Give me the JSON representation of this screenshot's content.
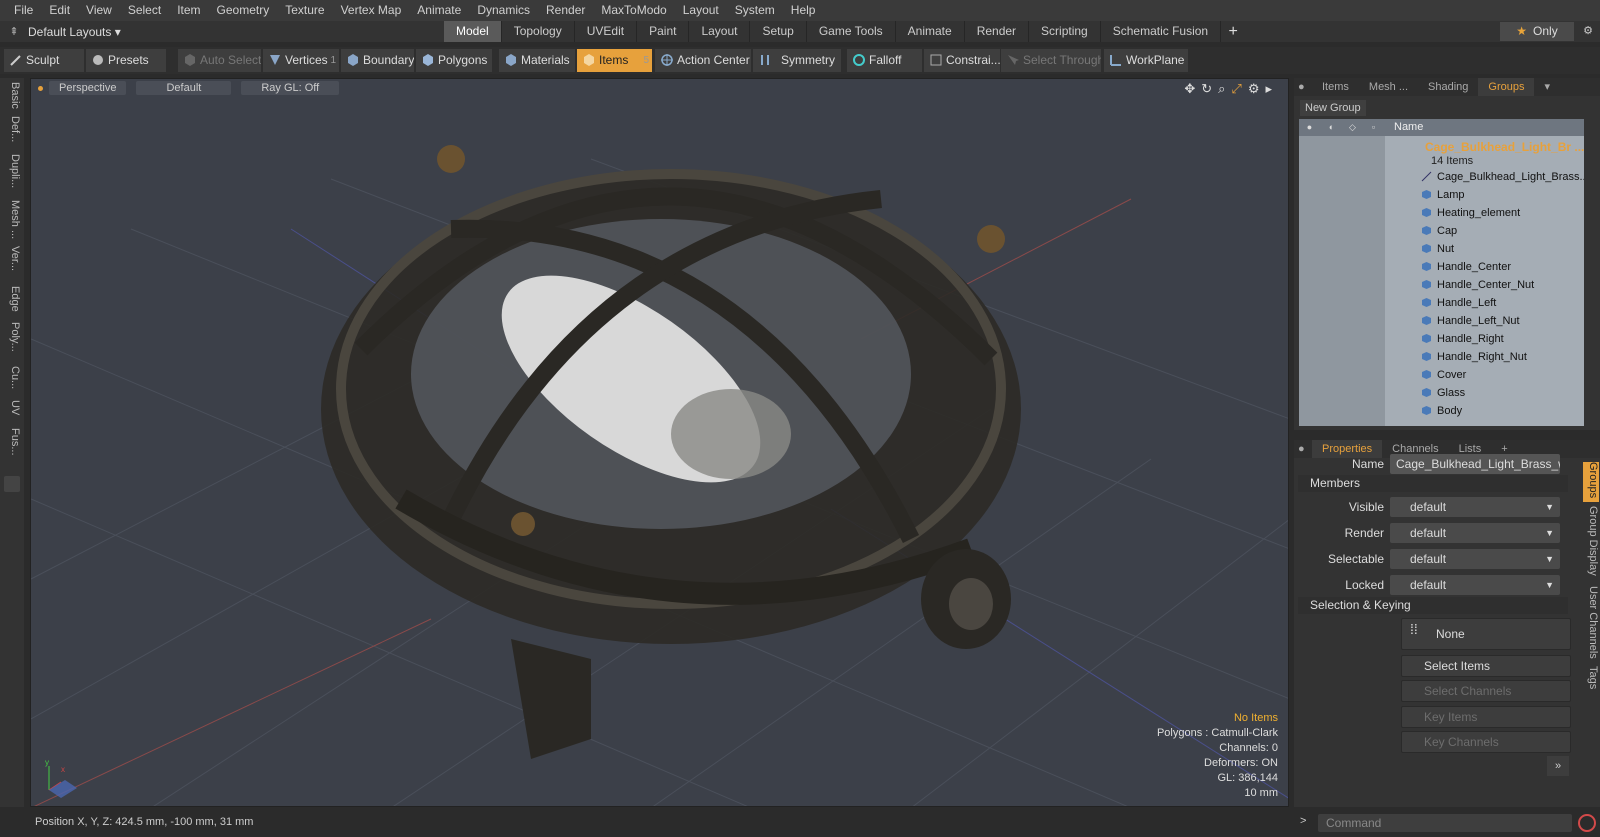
{
  "menu": [
    "File",
    "Edit",
    "View",
    "Select",
    "Item",
    "Geometry",
    "Texture",
    "Vertex Map",
    "Animate",
    "Dynamics",
    "Render",
    "MaxToModo",
    "Layout",
    "System",
    "Help"
  ],
  "layout_bar": {
    "layout_select": "Default Layouts ▾",
    "tabs": [
      "Model",
      "Topology",
      "UVEdit",
      "Paint",
      "Layout",
      "Setup",
      "Game Tools",
      "Animate",
      "Render",
      "Scripting",
      "Schematic Fusion"
    ],
    "active_tab": "Model",
    "only_label": "Only"
  },
  "toolbar": {
    "sculpt": "Sculpt",
    "presets": "Presets",
    "auto_select": "Auto Select",
    "vertices": "Vertices",
    "vertices_count": "1",
    "boundary": "Boundary",
    "polygons": "Polygons",
    "materials": "Materials",
    "items": "Items",
    "items_count": "5",
    "action_center": "Action Center",
    "symmetry": "Symmetry",
    "falloff": "Falloff",
    "constraints": "Constrai...",
    "select_through": "Select Through",
    "workplane": "WorkPlane"
  },
  "left_tabs": [
    "Basic",
    "Def...",
    "Dupli...",
    "Mesh ...",
    "Ver...",
    "Edge",
    "Poly...",
    "Cu...",
    "UV",
    "Fus..."
  ],
  "viewport": {
    "view_mode": "Perspective",
    "shading": "Default",
    "raygl": "Ray GL: Off",
    "info": {
      "selection": "No Items",
      "polygons": "Polygons : Catmull-Clark",
      "channels": "Channels: 0",
      "deformers": "Deformers: ON",
      "gl": "GL: 386,144",
      "scale": "10 mm"
    }
  },
  "status": {
    "position": "Position X, Y, Z:   424.5 mm, -100 mm, 31 mm"
  },
  "items_panel": {
    "tabs": [
      "Items",
      "Mesh ...",
      "Shading",
      "Groups"
    ],
    "active_tab": "Groups",
    "new_group": "New Group",
    "column_name": "Name",
    "group_name": "Cage_Bulkhead_Light_Br ...",
    "group_count": "14 Items",
    "items": [
      "Cage_Bulkhead_Light_Brass...",
      "Lamp",
      "Heating_element",
      "Cap",
      "Nut",
      "Handle_Center",
      "Handle_Center_Nut",
      "Handle_Left",
      "Handle_Left_Nut",
      "Handle_Right",
      "Handle_Right_Nut",
      "Cover",
      "Glass",
      "Body"
    ]
  },
  "properties_panel": {
    "tabs": [
      "Properties",
      "Channels",
      "Lists"
    ],
    "active_tab": "Properties",
    "name_label": "Name",
    "name_value": "Cage_Bulkhead_Light_Brass_with",
    "members_header": "Members",
    "visible_label": "Visible",
    "visible_value": "default",
    "render_label": "Render",
    "render_value": "default",
    "selectable_label": "Selectable",
    "selectable_value": "default",
    "locked_label": "Locked",
    "locked_value": "default",
    "sel_keying_header": "Selection & Keying",
    "none_label": "None",
    "select_items": "Select Items",
    "select_channels": "Select Channels",
    "key_items": "Key Items",
    "key_channels": "Key Channels",
    "side_tabs": [
      "Groups",
      "Group Display",
      "User Channels",
      "Tags"
    ]
  },
  "command": {
    "placeholder": "Command"
  },
  "colors": {
    "accent": "#e7a13c",
    "viewport_bg": "#3c4049",
    "tree_bg": "#a5adb5"
  }
}
